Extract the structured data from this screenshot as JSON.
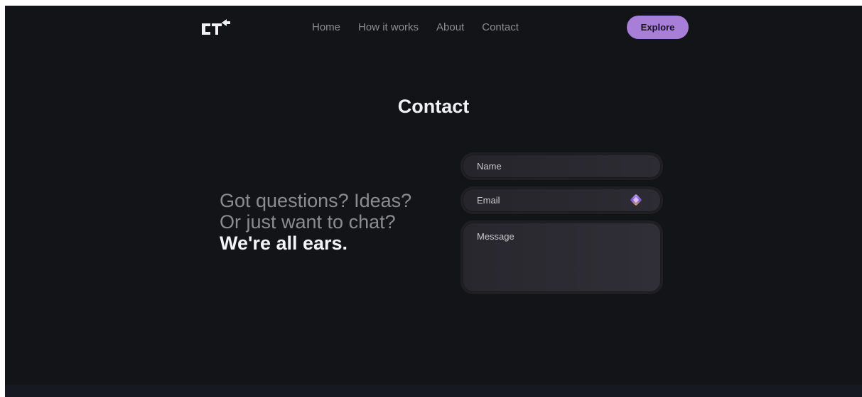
{
  "header": {
    "logo_text": "CT",
    "nav": [
      "Home",
      "How it works",
      "About",
      "Contact"
    ],
    "explore_label": "Explore"
  },
  "main": {
    "title": "Contact",
    "tagline_line1": "Got questions? Ideas?",
    "tagline_line2": "Or just want to chat?",
    "tagline_line3": "We're all ears."
  },
  "form": {
    "name_placeholder": "Name",
    "email_placeholder": "Email",
    "message_placeholder": "Message",
    "name_value": "",
    "email_value": "",
    "message_value": ""
  },
  "icons": {
    "logo": "ct-arrow-logo",
    "email_autofill": "password-manager-icon"
  },
  "colors": {
    "background": "#131418",
    "accent": "#a77fd9",
    "nav_text": "#8c8d93",
    "title": "#f2f2f4"
  }
}
